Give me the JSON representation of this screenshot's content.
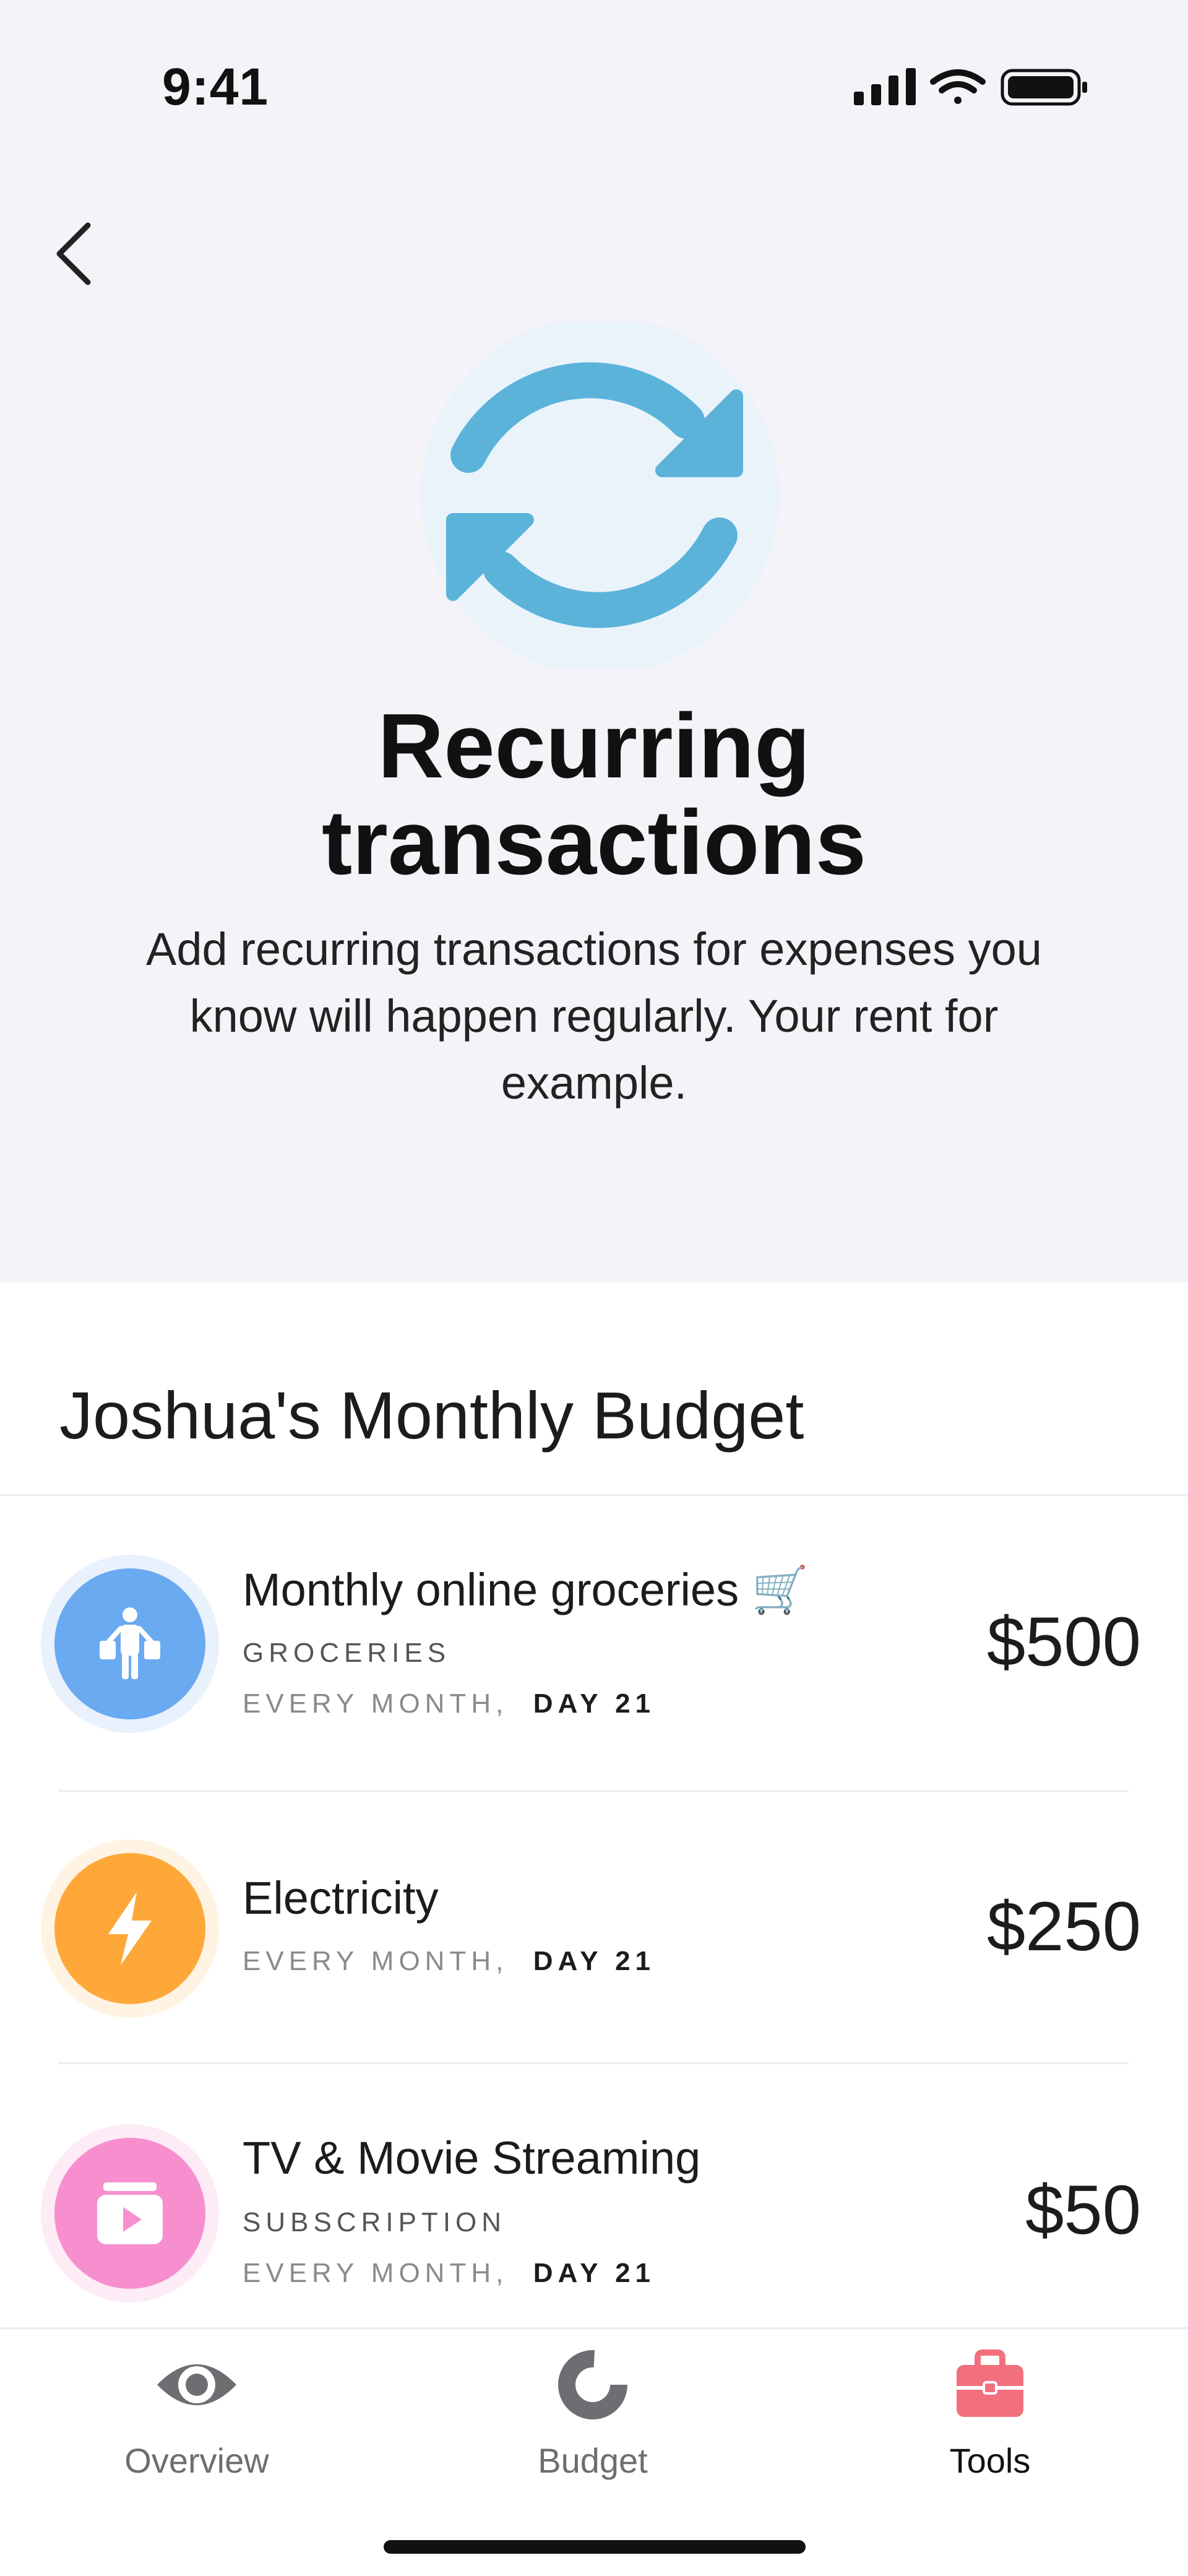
{
  "status_bar": {
    "time": "9:41"
  },
  "hero": {
    "title": "Recurring transactions",
    "description": "Add recurring transactions for expenses you know will happen regularly. Your rent for example."
  },
  "budget": {
    "title": "Joshua's Monthly Budget",
    "transactions": [
      {
        "name": "Monthly online groceries 🛒",
        "category": "GROCERIES",
        "schedule_prefix": "EVERY MONTH,",
        "schedule_day": "DAY 21",
        "amount": "$500",
        "icon": "shopping-person-icon",
        "color": "#6aaaf0"
      },
      {
        "name": "Electricity",
        "category": "",
        "schedule_prefix": "EVERY MONTH,",
        "schedule_day": "DAY 21",
        "amount": "$250",
        "icon": "lightning-icon",
        "color": "#ffa83a"
      },
      {
        "name": "TV & Movie Streaming",
        "category": "SUBSCRIPTION",
        "schedule_prefix": "EVERY MONTH,",
        "schedule_day": "DAY 21",
        "amount": "$50",
        "icon": "play-box-icon",
        "color": "#f78fcf"
      }
    ]
  },
  "tabs": [
    {
      "label": "Overview",
      "icon": "eye-icon",
      "active": false
    },
    {
      "label": "Budget",
      "icon": "donut-chart-icon",
      "active": false
    },
    {
      "label": "Tools",
      "icon": "toolbox-icon",
      "active": true
    }
  ],
  "colors": {
    "hero_background": "#f3f3f8",
    "accent_blue": "#5bb3da",
    "active_tab": "#f2707e"
  }
}
